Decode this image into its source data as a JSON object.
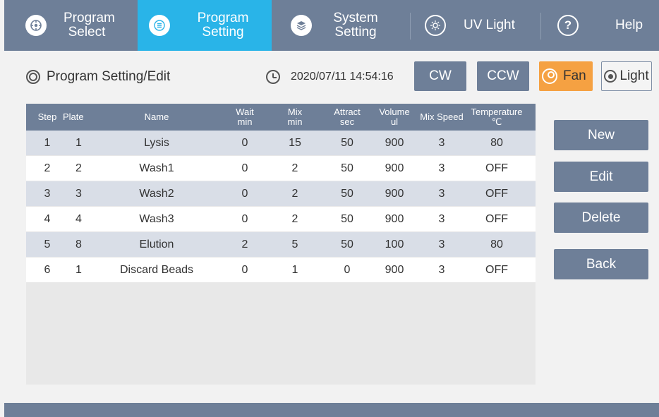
{
  "nav": {
    "program_select": "Program\nSelect",
    "program_setting": "Program\nSetting",
    "system_setting": "System\nSetting",
    "uv_light": "UV Light",
    "help": "Help"
  },
  "header": {
    "title": "Program Setting/Edit",
    "datetime": "2020/07/11 14:54:16"
  },
  "toolbar": {
    "cw": "CW",
    "ccw": "CCW",
    "fan": "Fan",
    "light": "Light"
  },
  "table": {
    "columns": [
      {
        "label": "Step"
      },
      {
        "label": "Plate"
      },
      {
        "label": "Name"
      },
      {
        "label": "Wait\nmin"
      },
      {
        "label": "Mix\nmin"
      },
      {
        "label": "Attract\nsec"
      },
      {
        "label": "Volume\nul"
      },
      {
        "label": "Mix Speed"
      },
      {
        "label": "Temperature\n℃"
      }
    ],
    "rows": [
      [
        "1",
        "1",
        "Lysis",
        "0",
        "15",
        "50",
        "900",
        "3",
        "80"
      ],
      [
        "2",
        "2",
        "Wash1",
        "0",
        "2",
        "50",
        "900",
        "3",
        "OFF"
      ],
      [
        "3",
        "3",
        "Wash2",
        "0",
        "2",
        "50",
        "900",
        "3",
        "OFF"
      ],
      [
        "4",
        "4",
        "Wash3",
        "0",
        "2",
        "50",
        "900",
        "3",
        "OFF"
      ],
      [
        "5",
        "8",
        "Elution",
        "2",
        "5",
        "50",
        "100",
        "3",
        "80"
      ],
      [
        "6",
        "1",
        "Discard Beads",
        "0",
        "1",
        "0",
        "900",
        "3",
        "OFF"
      ]
    ]
  },
  "actions": {
    "new": "New",
    "edit": "Edit",
    "delete": "Delete",
    "back": "Back"
  },
  "colors": {
    "nav_bg": "#6e7f98",
    "nav_active": "#29b4e8",
    "fan_active": "#f5a142",
    "row_alt": "#d9dee7"
  }
}
